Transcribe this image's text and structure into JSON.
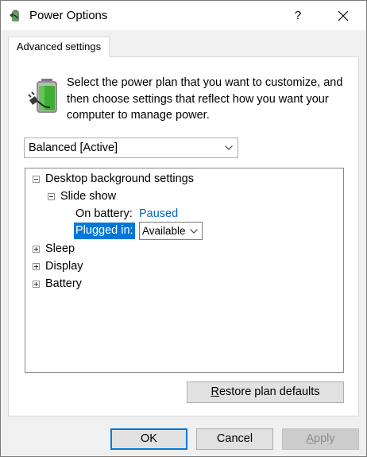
{
  "window": {
    "title": "Power Options",
    "help_label": "?"
  },
  "tab": {
    "label": "Advanced settings"
  },
  "description": "Select the power plan that you want to customize, and then choose settings that reflect how you want your computer to manage power.",
  "plan_select": {
    "value": "Balanced [Active]"
  },
  "tree": {
    "desktop_background": "Desktop background settings",
    "slide_show": "Slide show",
    "on_battery_label": "On battery:",
    "on_battery_value": "Paused",
    "plugged_in_label": "Plugged in:",
    "plugged_in_value": "Available",
    "sleep": "Sleep",
    "display": "Display",
    "battery": "Battery"
  },
  "buttons": {
    "restore_access_key": "R",
    "restore_rest": "estore plan defaults",
    "ok": "OK",
    "cancel": "Cancel",
    "apply_access_key": "A",
    "apply_rest": "pply"
  },
  "colors": {
    "accent": "#0078d7",
    "link": "#0066cc"
  },
  "icons": {
    "title": "battery-plug-icon",
    "help": "help-icon",
    "close": "close-icon",
    "plan": "battery-plug-icon"
  }
}
